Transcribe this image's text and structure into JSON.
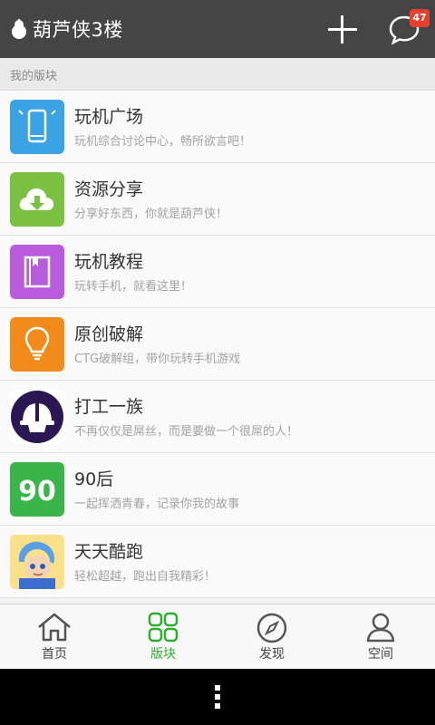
{
  "header": {
    "title": "葫芦侠3楼",
    "message_badge": "47",
    "icons": {
      "logo": "gourd-logo-icon",
      "add": "plus-icon",
      "messages": "chat-bubble-icon"
    }
  },
  "section": {
    "title": "我的版块"
  },
  "boards": [
    {
      "name": "玩机广场",
      "desc": "玩机综合讨论中心，畅所欲言吧！",
      "icon": "phone-icon",
      "color": "#3aa3e3"
    },
    {
      "name": "资源分享",
      "desc": "分享好东西，你就是葫芦侠！",
      "icon": "cloud-download-icon",
      "color": "#7ac142"
    },
    {
      "name": "玩机教程",
      "desc": "玩转手机，就看这里！",
      "icon": "book-icon",
      "color": "#b85bdc"
    },
    {
      "name": "原创破解",
      "desc": "CTG破解组，带你玩转手机游戏",
      "icon": "lightbulb-icon",
      "color": "#f28a1c"
    },
    {
      "name": "打工一族",
      "desc": "不再仅仅是屌丝，而是要做一个很屌的人！",
      "icon": "worker-helmet-icon",
      "color": "#2c1654"
    },
    {
      "name": "90后",
      "desc": "一起挥洒青春，记录你我的故事",
      "icon": "ninety-icon",
      "color": "#39b54a"
    },
    {
      "name": "天天酷跑",
      "desc": "轻松超越，跑出自我精彩！",
      "icon": "game-character-icon",
      "color": "#f5c54a"
    }
  ],
  "nav": [
    {
      "label": "首页",
      "icon": "home-icon",
      "active": false
    },
    {
      "label": "版块",
      "icon": "grid-icon",
      "active": true
    },
    {
      "label": "发现",
      "icon": "compass-icon",
      "active": false
    },
    {
      "label": "空间",
      "icon": "person-icon",
      "active": false
    }
  ],
  "colors": {
    "topbar": "#454545",
    "accent": "#2fae2f",
    "badge": "#e8402e"
  }
}
